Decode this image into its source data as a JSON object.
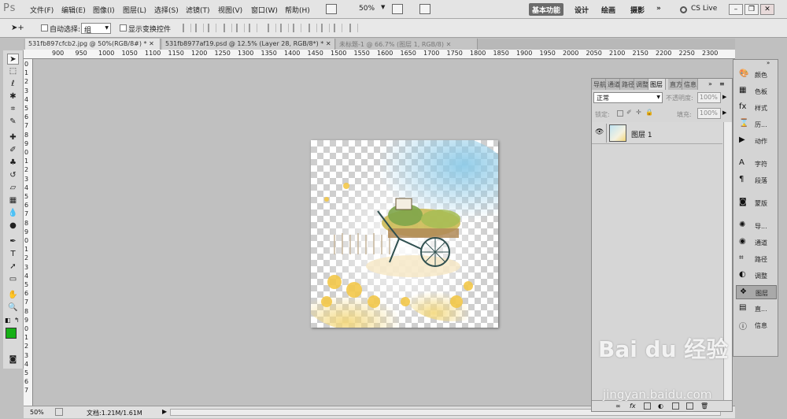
{
  "app": {
    "logo": "Ps"
  },
  "menu": [
    "文件(F)",
    "编辑(E)",
    "图像(I)",
    "图层(L)",
    "选择(S)",
    "滤镜(T)",
    "视图(V)",
    "窗口(W)",
    "帮助(H)"
  ],
  "menubar_zoom": "50%",
  "workspaces": {
    "active": "基本功能",
    "items": [
      "设计",
      "绘画",
      "摄影"
    ],
    "more": "»",
    "cslive": "CS Live"
  },
  "options": {
    "auto_select_label": "自动选择:",
    "auto_select_value": "组",
    "show_transform_label": "显示变换控件"
  },
  "tabs": [
    {
      "label": "531fb897cfcb2.jpg @ 50%(RGB/8#) *"
    },
    {
      "label": "531fb8977af19.psd @ 12.5% (Layer 28, RGB/8*) *"
    },
    {
      "label": "未标题-1 @ 66.7% (图层 1, RGB/8)"
    }
  ],
  "ruler_top": [
    "900",
    "950",
    "1000",
    "1050",
    "1100",
    "1150",
    "1200",
    "1250",
    "1300",
    "1350",
    "1400",
    "1450",
    "1500",
    "1550",
    "1600",
    "1650",
    "1700",
    "1750",
    "1800",
    "1850",
    "1900",
    "1950",
    "2000",
    "2050",
    "2100",
    "2150",
    "2200",
    "2250",
    "2300"
  ],
  "ruler_left": [
    "0",
    "1",
    "2",
    "3",
    "4",
    "5",
    "6",
    "7",
    "8",
    "9",
    "0",
    "1",
    "2",
    "3",
    "4",
    "5",
    "6",
    "7",
    "8",
    "9",
    "0",
    "1",
    "2",
    "3",
    "4",
    "5",
    "6",
    "7",
    "8",
    "9",
    "0",
    "1",
    "2",
    "3",
    "4",
    "5",
    "6",
    "7"
  ],
  "status": {
    "zoom": "50%",
    "doc": "文档:1.21M/1.61M"
  },
  "layers": {
    "tabs": [
      "导航",
      "通道",
      "路径",
      "调整",
      "图层",
      "直方",
      "信息"
    ],
    "blend_mode": "正常",
    "opacity_label": "不透明度:",
    "opacity_value": "100%",
    "lock_label": "锁定:",
    "fill_label": "填充:",
    "fill_value": "100%",
    "items": [
      {
        "name": "图层 1"
      }
    ]
  },
  "dock": [
    {
      "label": "颜色",
      "icon": "color-icon"
    },
    {
      "label": "色板",
      "icon": "swatches-icon"
    },
    {
      "label": "样式",
      "icon": "styles-icon"
    },
    {
      "label": "历...",
      "icon": "history-icon"
    },
    {
      "label": "动作",
      "icon": "actions-icon"
    },
    {
      "label": "字符",
      "icon": "character-icon"
    },
    {
      "label": "段落",
      "icon": "paragraph-icon"
    },
    {
      "label": "蒙版",
      "icon": "masks-icon"
    },
    {
      "label": "导...",
      "icon": "navigator-icon"
    },
    {
      "label": "通道",
      "icon": "channels-icon"
    },
    {
      "label": "路径",
      "icon": "paths-icon"
    },
    {
      "label": "调整",
      "icon": "adjustments-icon"
    },
    {
      "label": "图层",
      "icon": "layers-icon"
    },
    {
      "label": "直...",
      "icon": "histogram-icon"
    },
    {
      "label": "信息",
      "icon": "info-icon"
    }
  ],
  "colors": {
    "foreground": "#16b016",
    "background": "#ffffff",
    "workspace_active": "#6b6b6b",
    "canvas": "#c0c0c0"
  },
  "watermark": {
    "brand": "Bai du 经验",
    "url": "jingyan.baidu.com"
  }
}
